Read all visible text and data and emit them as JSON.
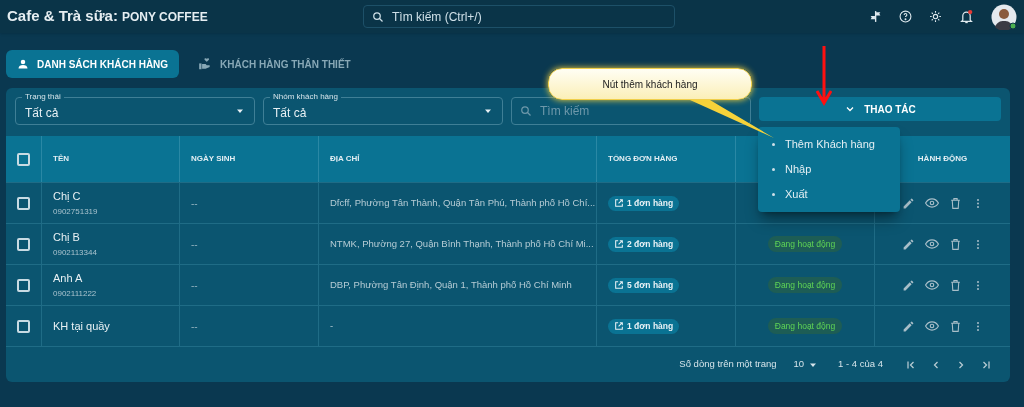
{
  "header": {
    "title": "Cafe & Trà sữa:",
    "store": "PONY COFFEE",
    "search": {
      "placeholder": "Tìm kiếm (Ctrl+/)"
    }
  },
  "tabs": [
    {
      "label": "DANH SÁCH KHÁCH HÀNG",
      "selected": true
    },
    {
      "label": "KHÁCH HÀNG THÂN THIẾT",
      "selected": false
    }
  ],
  "filters": [
    {
      "label": "Trạng thái",
      "value": "Tất cả"
    },
    {
      "label": "Nhóm khách hàng",
      "value": "Tất cả"
    }
  ],
  "search": {
    "placeholder": "Tìm kiếm"
  },
  "actions_button": {
    "label": "THAO TÁC",
    "expanded": true
  },
  "actions_menu": [
    "Thêm Khách hàng",
    "Nhập",
    "Xuất"
  ],
  "callout": "Nút thêm khách hàng",
  "table": {
    "select_all": false,
    "columns": [
      "TÊN",
      "NGÀY SINH",
      "ĐỊA CHỈ",
      "TỔNG ĐƠN HÀNG",
      "HÀNH ĐỘNG"
    ],
    "rows": [
      {
        "name": "Chị C",
        "phone": "0902751319",
        "birthday": "--",
        "address": "Dfcff, Phường Tân Thành, Quận Tân Phú, Thành phố Hồ Chí...",
        "orders": "1 đơn hàng",
        "checked": false
      },
      {
        "name": "Chị B",
        "phone": "0902113344",
        "birthday": "--",
        "address": "NTMK, Phường 27, Quận Bình Thạnh, Thành phố Hồ Chí Mi...",
        "orders": "2 đơn hàng",
        "status": "Đang hoạt động",
        "checked": false
      },
      {
        "name": "Anh A",
        "phone": "0902111222",
        "birthday": "--",
        "address": "DBP, Phường Tân Định, Quận 1, Thành phố Hồ Chí Minh",
        "orders": "5 đơn hàng",
        "status": "Đang hoạt động",
        "checked": false
      },
      {
        "name": "KH tại quầy",
        "birthday": "--",
        "address": "-",
        "orders": "1 đơn hàng",
        "status": "Đang hoạt động",
        "checked": false
      }
    ]
  },
  "pagination": {
    "rows_label": "Số dòng trên một trang",
    "rows_per_page": "10",
    "range": "1 - 4 của 4"
  }
}
